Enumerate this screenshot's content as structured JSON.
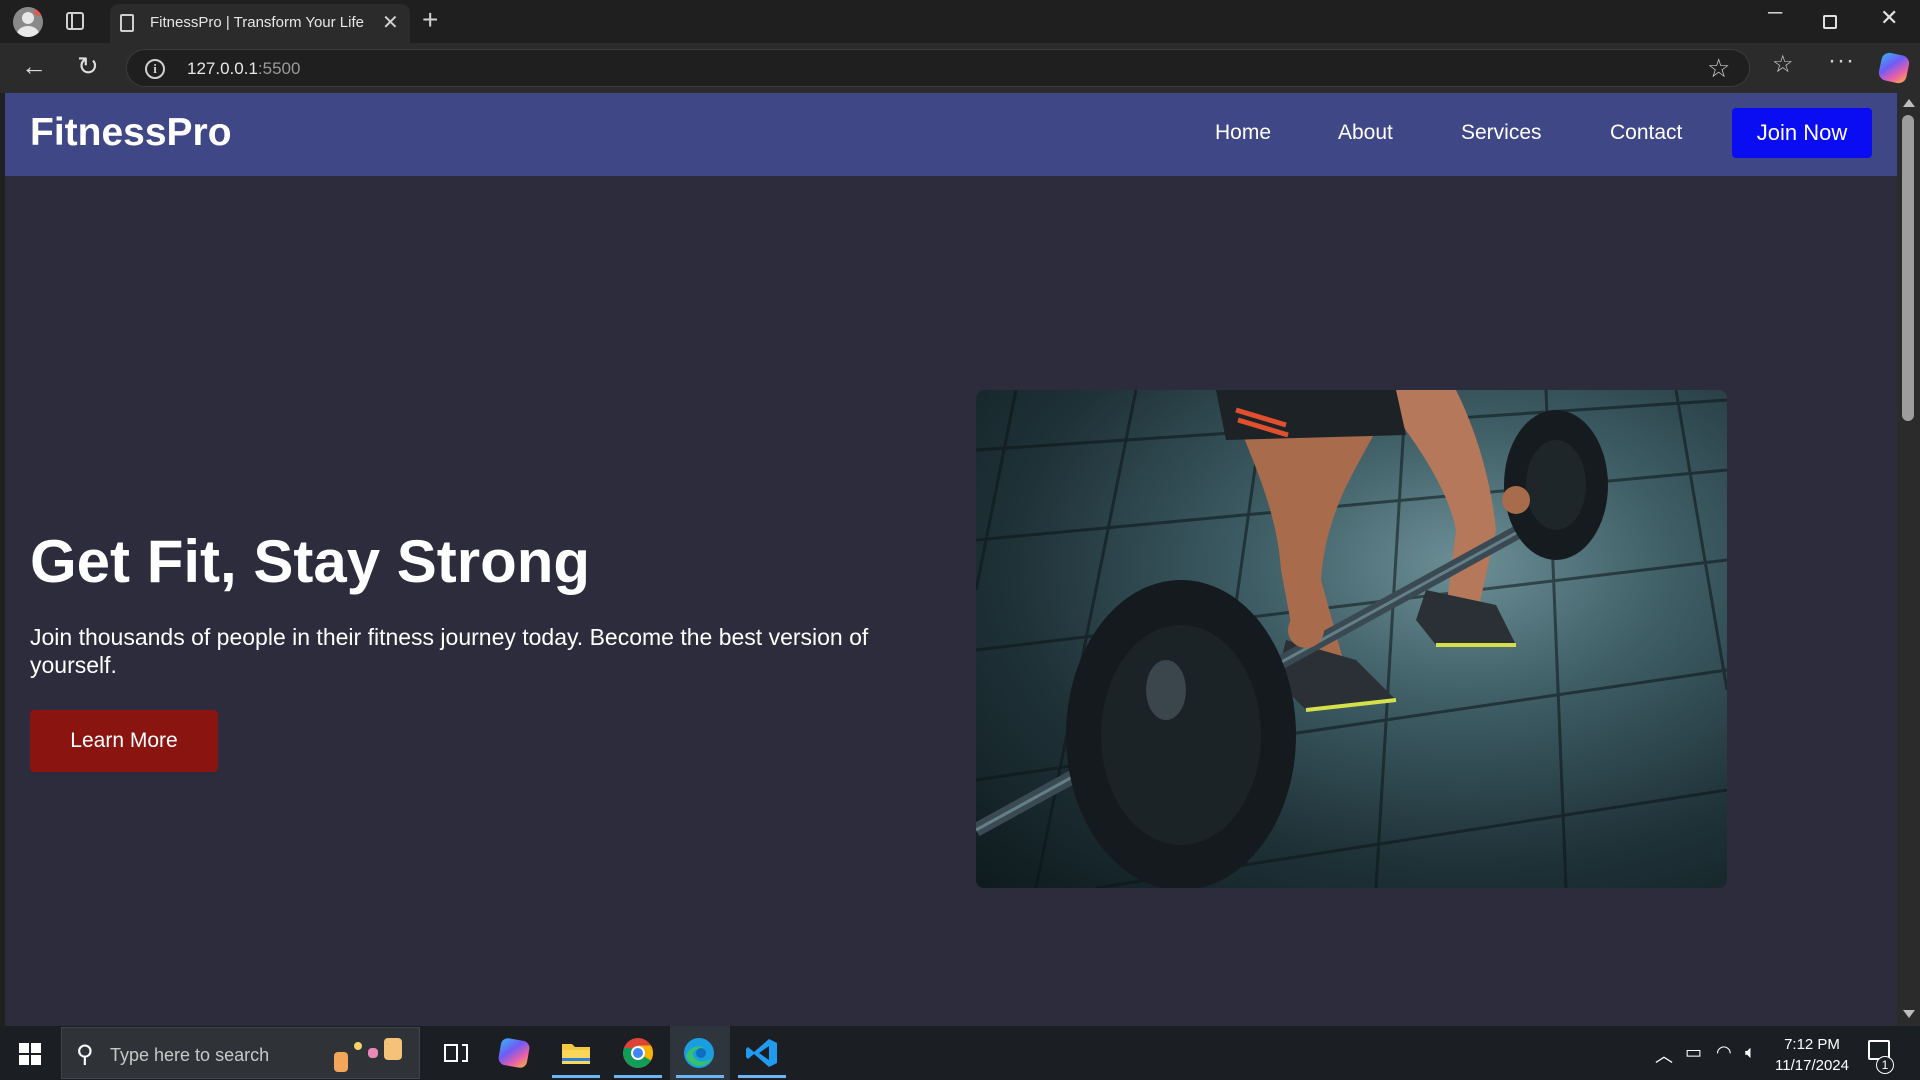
{
  "browser": {
    "tab_title": "FitnessPro | Transform Your Life",
    "url_host": "127.0.0.1",
    "url_port": ":5500"
  },
  "site": {
    "logo": "FitnessPro",
    "nav": {
      "home": "Home",
      "about": "About",
      "services": "Services",
      "contact": "Contact"
    },
    "join_button": "Join Now",
    "hero": {
      "title": "Get Fit, Stay Strong",
      "subtitle": "Join thousands of people in their fitness journey today. Become the best version of yourself.",
      "cta": "Learn More"
    },
    "colors": {
      "nav_bg": "#404787",
      "page_bg": "#2c2c3d",
      "join_button": "#0a0cf2",
      "cta_button": "#8a1410"
    }
  },
  "taskbar": {
    "search_placeholder": "Type here to search",
    "time": "7:12 PM",
    "date": "11/17/2024",
    "notification_count": "1"
  }
}
